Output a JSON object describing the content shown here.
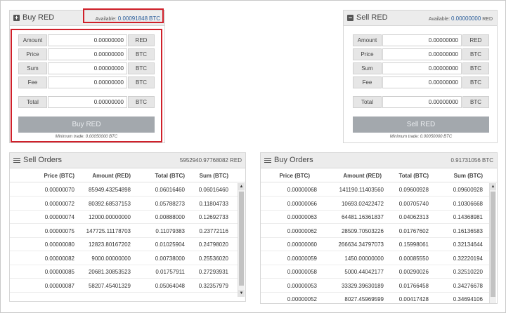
{
  "buy_panel": {
    "title": "Buy RED",
    "available_label": "Available:",
    "available_value": "0.00091848",
    "available_unit": "BTC",
    "fields": [
      {
        "label": "Amount",
        "value": "0.00000000",
        "unit": "RED"
      },
      {
        "label": "Price",
        "value": "0.00000000",
        "unit": "BTC"
      },
      {
        "label": "Sum",
        "value": "0.00000000",
        "unit": "BTC"
      },
      {
        "label": "Fee",
        "value": "0.00000000",
        "unit": "BTC"
      },
      {
        "label": "Total",
        "value": "0.00000000",
        "unit": "BTC"
      }
    ],
    "button_label": "Buy RED",
    "min_trade": "Minimum trade: 0.00050000 BTC"
  },
  "sell_panel": {
    "title": "Sell RED",
    "available_label": "Available:",
    "available_value": "0.00000000",
    "available_unit": "RED",
    "fields": [
      {
        "label": "Amount",
        "value": "0.00000000",
        "unit": "RED"
      },
      {
        "label": "Price",
        "value": "0.00000000",
        "unit": "BTC"
      },
      {
        "label": "Sum",
        "value": "0.00000000",
        "unit": "BTC"
      },
      {
        "label": "Fee",
        "value": "0.00000000",
        "unit": "BTC"
      },
      {
        "label": "Total",
        "value": "0.00000000",
        "unit": "BTC"
      }
    ],
    "button_label": "Sell RED",
    "min_trade": "Minimum trade: 0.00050000 BTC"
  },
  "sell_orders": {
    "title": "Sell Orders",
    "total": "5952940.97768082 RED",
    "columns": [
      "Price (BTC)",
      "Amount (RED)",
      "Total (BTC)",
      "Sum (BTC)"
    ],
    "rows": [
      [
        "0.00000070",
        "85949.43254898",
        "0.06016460",
        "0.06016460"
      ],
      [
        "0.00000072",
        "80392.68537153",
        "0.05788273",
        "0.11804733"
      ],
      [
        "0.00000074",
        "12000.00000000",
        "0.00888000",
        "0.12692733"
      ],
      [
        "0.00000075",
        "147725.11178703",
        "0.11079383",
        "0.23772116"
      ],
      [
        "0.00000080",
        "12823.80167202",
        "0.01025904",
        "0.24798020"
      ],
      [
        "0.00000082",
        "9000.00000000",
        "0.00738000",
        "0.25536020"
      ],
      [
        "0.00000085",
        "20681.30853523",
        "0.01757911",
        "0.27293931"
      ],
      [
        "0.00000087",
        "58207.45401329",
        "0.05064048",
        "0.32357979"
      ]
    ]
  },
  "buy_orders": {
    "title": "Buy Orders",
    "total": "0.91731056 BTC",
    "columns": [
      "Price (BTC)",
      "Amount (RED)",
      "Total (BTC)",
      "Sum (BTC)"
    ],
    "rows": [
      [
        "0.00000068",
        "141190.11403560",
        "0.09600928",
        "0.09600928"
      ],
      [
        "0.00000066",
        "10693.02422472",
        "0.00705740",
        "0.10306668"
      ],
      [
        "0.00000063",
        "64481.16361837",
        "0.04062313",
        "0.14368981"
      ],
      [
        "0.00000062",
        "28509.70503226",
        "0.01767602",
        "0.16136583"
      ],
      [
        "0.00000060",
        "266634.34797073",
        "0.15998061",
        "0.32134644"
      ],
      [
        "0.00000059",
        "1450.00000000",
        "0.00085550",
        "0.32220194"
      ],
      [
        "0.00000058",
        "5000.44042177",
        "0.00290026",
        "0.32510220"
      ],
      [
        "0.00000053",
        "33329.39630189",
        "0.01766458",
        "0.34276678"
      ],
      [
        "0.00000052",
        "8027.45969599",
        "0.00417428",
        "0.34694106"
      ]
    ]
  },
  "colors": {
    "highlight": "#d0202a",
    "button": "#a3a8ad",
    "accent_text": "#2a5d9a"
  },
  "icons": {
    "buy_panel": "plus-square-icon",
    "sell_panel": "minus-square-icon",
    "orders": "list-icon"
  }
}
